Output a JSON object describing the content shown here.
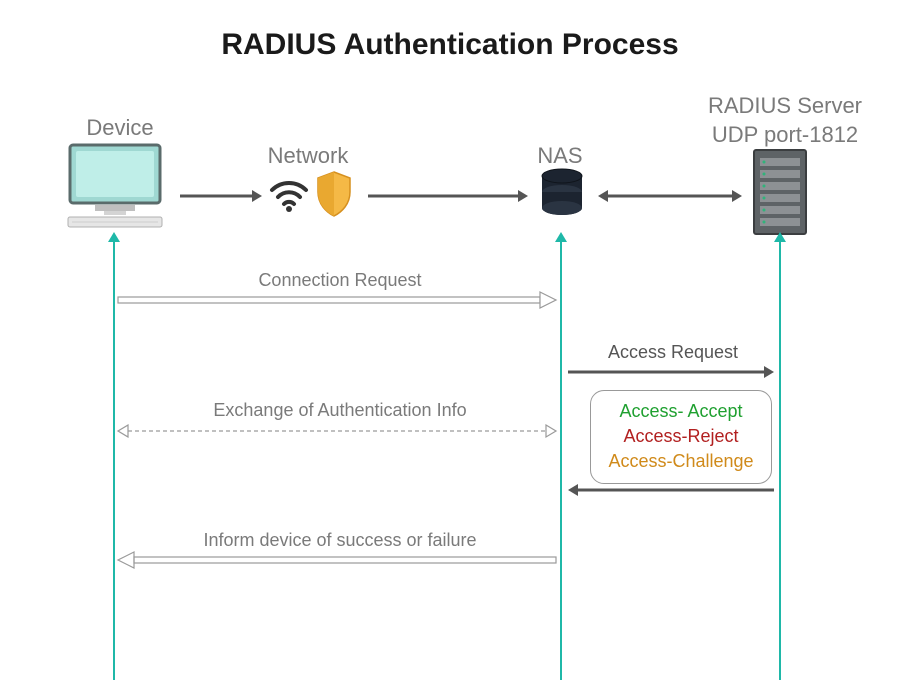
{
  "title": "RADIUS Authentication Process",
  "nodes": {
    "device": {
      "label": "Device"
    },
    "network": {
      "label": "Network"
    },
    "nas": {
      "label": "NAS"
    },
    "radius": {
      "label_line1": "RADIUS Server",
      "label_line2": "UDP port-1812"
    }
  },
  "messages": {
    "connection_request": "Connection Request",
    "access_request": "Access Request",
    "exchange_auth_info": "Exchange of Authentication Info",
    "inform_result": "Inform device of success or failure"
  },
  "responses": {
    "accept": "Access- Accept",
    "reject": "Access-Reject",
    "challenge": "Access-Challenge"
  }
}
